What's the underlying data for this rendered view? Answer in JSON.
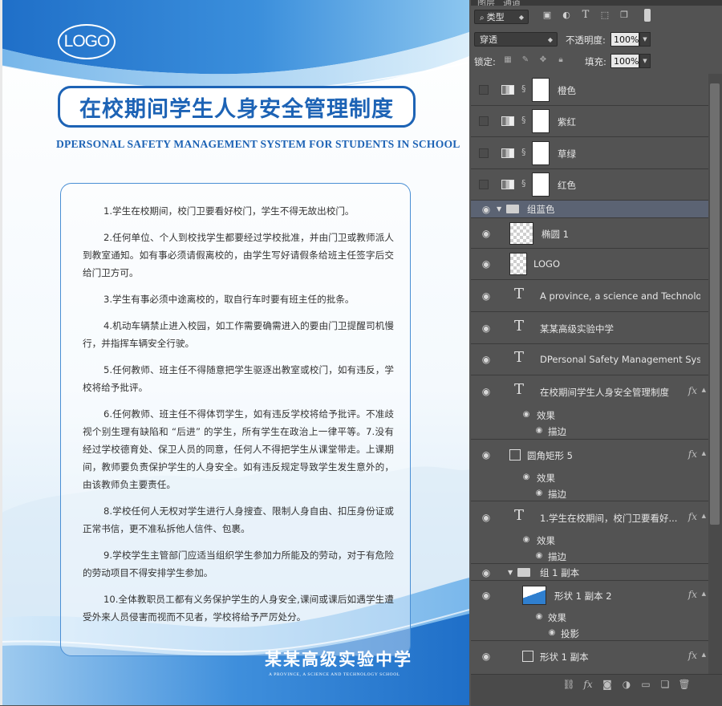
{
  "poster": {
    "logo_text": "LOGO",
    "title": "在校期间学生人身安全管理制度",
    "subtitle": "DPERSONAL SAFETY MANAGEMENT SYSTEM FOR STUDENTS IN SCHOOL",
    "rules": [
      "1.学生在校期间，校门卫要看好校门，学生不得无故出校门。",
      "2.任何单位、个人到校找学生都要经过学校批准，并由门卫或教师派人到教室通知。如有事必须请假离校的，由学生写好请假条给班主任签字后交给门卫方可。",
      "3.学生有事必须中途离校的，取自行车时要有班主任的批条。",
      "4.机动车辆禁止进入校园，如工作需要确需进入的要由门卫提醒司机慢行，并指挥车辆安全行驶。",
      "5.任何教师、班主任不得随意把学生驱逐出教室或校门，如有违反，学校将给予批评。",
      "6.任何教师、班主任不得体罚学生，如有违反学校将给予批评。不准歧视个别生理有缺陷和 “后进” 的学生，所有学生在政治上一律平等。7.没有经过学校德育处、保卫人员的同意，任何人不得把学生从课堂带走。上课期间，教师要负责保护学生的人身安全。如有违反规定导致学生发生意外的，由该教师负主要责任。",
      "8.学校任何人无权对学生进行人身搜查、限制人身自由、扣压身份证或正常书信，更不准私拆他人信件、包裹。",
      "9.学校学生主管部门应适当组织学生参加力所能及的劳动，对于有危险的劳动项目不得安排学生参加。",
      "10.全体教职员工都有义务保护学生的人身安全,课间或课后如遇学生遭受外来人员侵害而视而不见者，学校将给予严厉处分。"
    ],
    "school_name": "某某高级实验中学",
    "school_en": "A PROVINCE, A SCIENCE AND TECHNOLOGY SCHOOL"
  },
  "panel": {
    "tabs": [
      "图层",
      "通道"
    ],
    "filter_select": "类型",
    "blend_mode": "穿透",
    "opacity_label": "不透明度:",
    "opacity_value": "100%",
    "lock_label": "锁定:",
    "fill_label": "填充:",
    "fill_value": "100%",
    "layers": {
      "orange": "橙色",
      "purple_red": "紫红",
      "grass_green": "草绿",
      "red": "红色",
      "group_blue": "组蓝色",
      "ellipse": "椭圆 1",
      "logo": "LOGO",
      "text_province": "A province, a science and Technology...",
      "text_school": "某某高级实验中学",
      "text_dpersonal": "DPersonal Safety Management Syste...",
      "text_title": "在校期间学生人身安全管理制度",
      "rounded_rect": "圆角矩形 5",
      "text_rules": "1.学生在校期间，校门卫要看好...",
      "group_copy": "组 1 副本",
      "shape_copy2": "形状 1 副本 2",
      "shape_copy": "形状 1 副本"
    },
    "effects_label": "效果",
    "stroke_label": "描边",
    "shadow_label": "投影",
    "fx_label": "fx"
  }
}
